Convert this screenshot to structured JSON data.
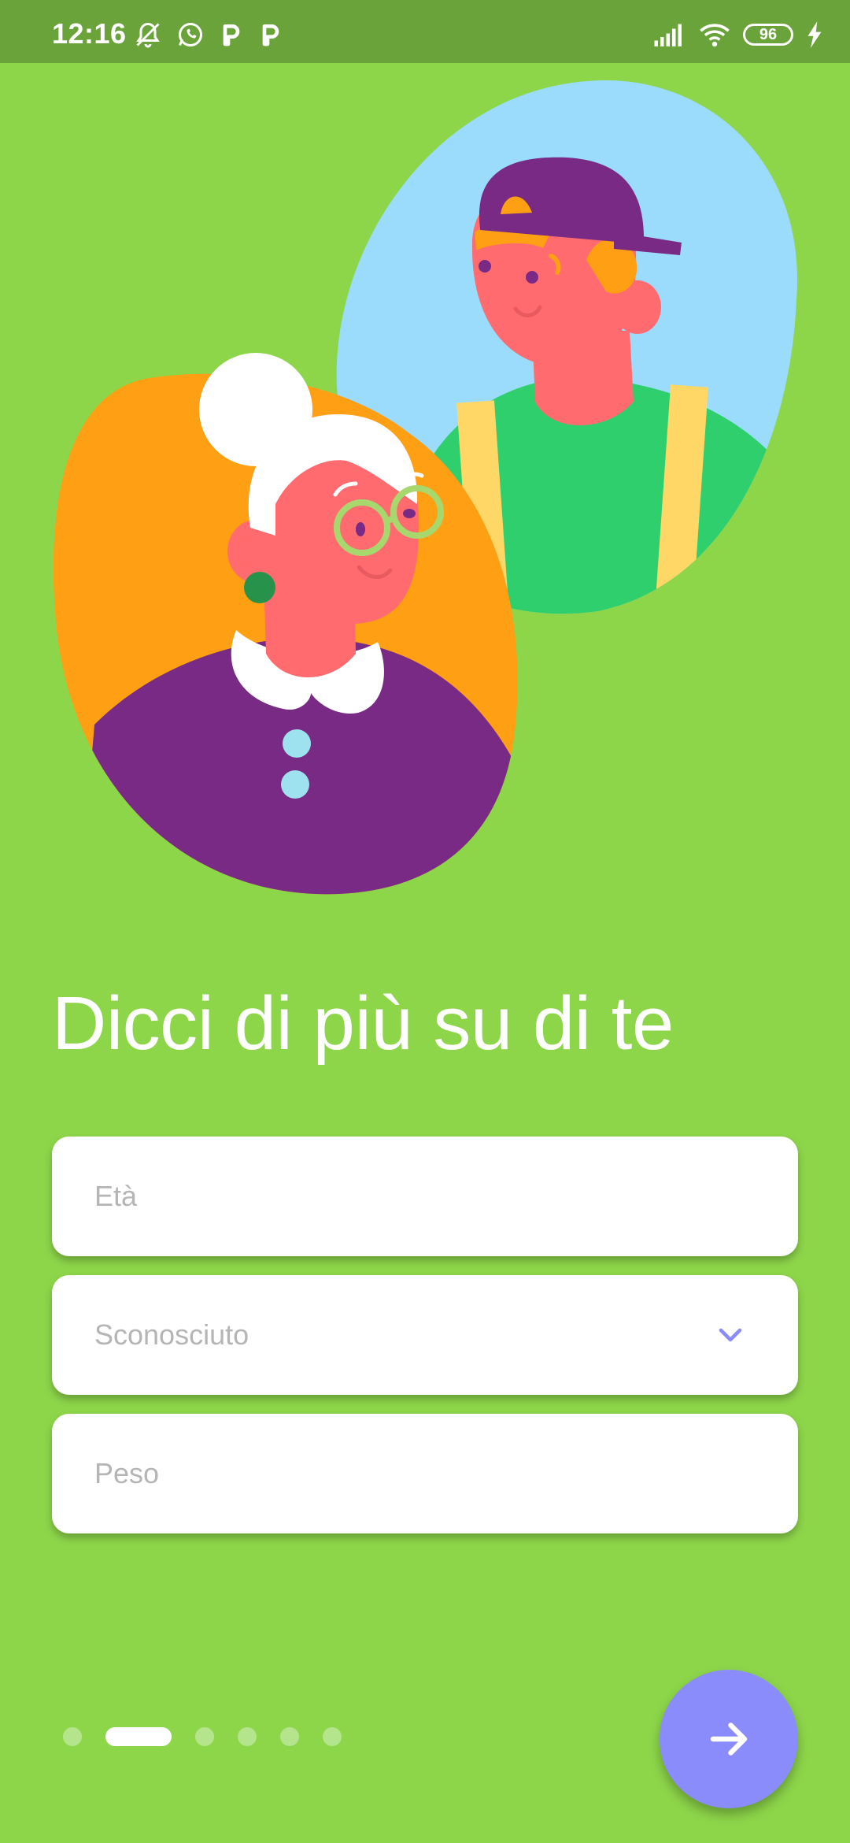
{
  "status_bar": {
    "time": "12:16",
    "battery_level": "96",
    "left_icons": [
      "bell-off-icon",
      "whatsapp-icon",
      "p-app-icon",
      "p-app-icon"
    ],
    "right_icons": [
      "signal-icon",
      "wifi-icon",
      "battery-icon",
      "charging-icon"
    ]
  },
  "illustration": {
    "subject": "elderly-woman-and-young-man-avatars",
    "colors": {
      "blue_blob": "#9bdcfd",
      "orange_blob": "#ff9f13",
      "skin": "#ff6b6f",
      "purple": "#792a85",
      "green_shirt": "#2ecf6c",
      "suspenders": "#ffd767",
      "glasses": "#8dd64a",
      "earring": "#27934a",
      "buttons": "#9ee2f0"
    }
  },
  "page": {
    "title": "Dicci di più su di te"
  },
  "form": {
    "age_placeholder": "Età",
    "gender_value": "Sconosciuto",
    "weight_placeholder": "Peso"
  },
  "pager": {
    "total": 6,
    "current": 2
  },
  "next_button": {
    "icon": "arrow-right-icon"
  },
  "colors": {
    "background": "#8dd64a",
    "status_bar": "#6aa33a",
    "accent": "#8b8cfb",
    "placeholder": "#b5b5b5"
  }
}
